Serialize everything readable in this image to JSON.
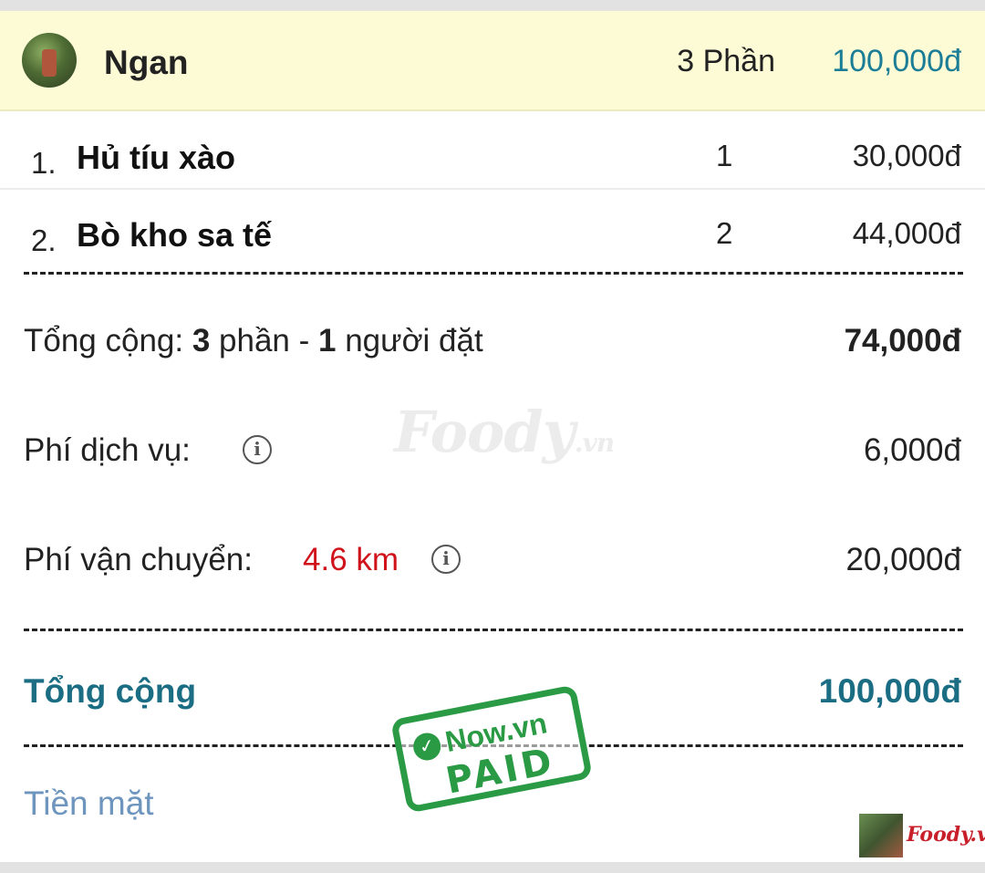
{
  "user": {
    "name": "Ngan",
    "portions": "3 Phần",
    "total": "100,000đ"
  },
  "items": [
    {
      "index": "1.",
      "name": "Hủ tíu xào",
      "qty": "1",
      "price": "30,000đ"
    },
    {
      "index": "2.",
      "name": "Bò kho sa tế",
      "qty": "2",
      "price": "44,000đ"
    }
  ],
  "summary": {
    "subtotal_prefix": "Tổng cộng: ",
    "subtotal_portions": "3",
    "subtotal_mid": " phần - ",
    "subtotal_people": "1",
    "subtotal_suffix": " người đặt",
    "subtotal_value": "74,000đ",
    "service_label": "Phí dịch vụ:",
    "service_value": "6,000đ",
    "shipping_label": "Phí vận chuyển:",
    "shipping_distance": "4.6 km",
    "shipping_value": "20,000đ",
    "info_glyph": "i"
  },
  "grand_total": {
    "label": "Tổng cộng",
    "value": "100,000đ"
  },
  "payment_method": "Tiền mặt",
  "watermark": {
    "main": "Foody",
    "suffix": ".vn"
  },
  "stamp": {
    "check": "✓",
    "brand": "Now.vn",
    "status": "PAID"
  },
  "corner_logo": {
    "brand": "Foody.vn"
  },
  "colors": {
    "accent": "#1b6d84",
    "highlight_bg": "#fdfbd5",
    "distance": "#d0121b",
    "payment": "#6d95bd",
    "stamp": "#2a9a45"
  }
}
